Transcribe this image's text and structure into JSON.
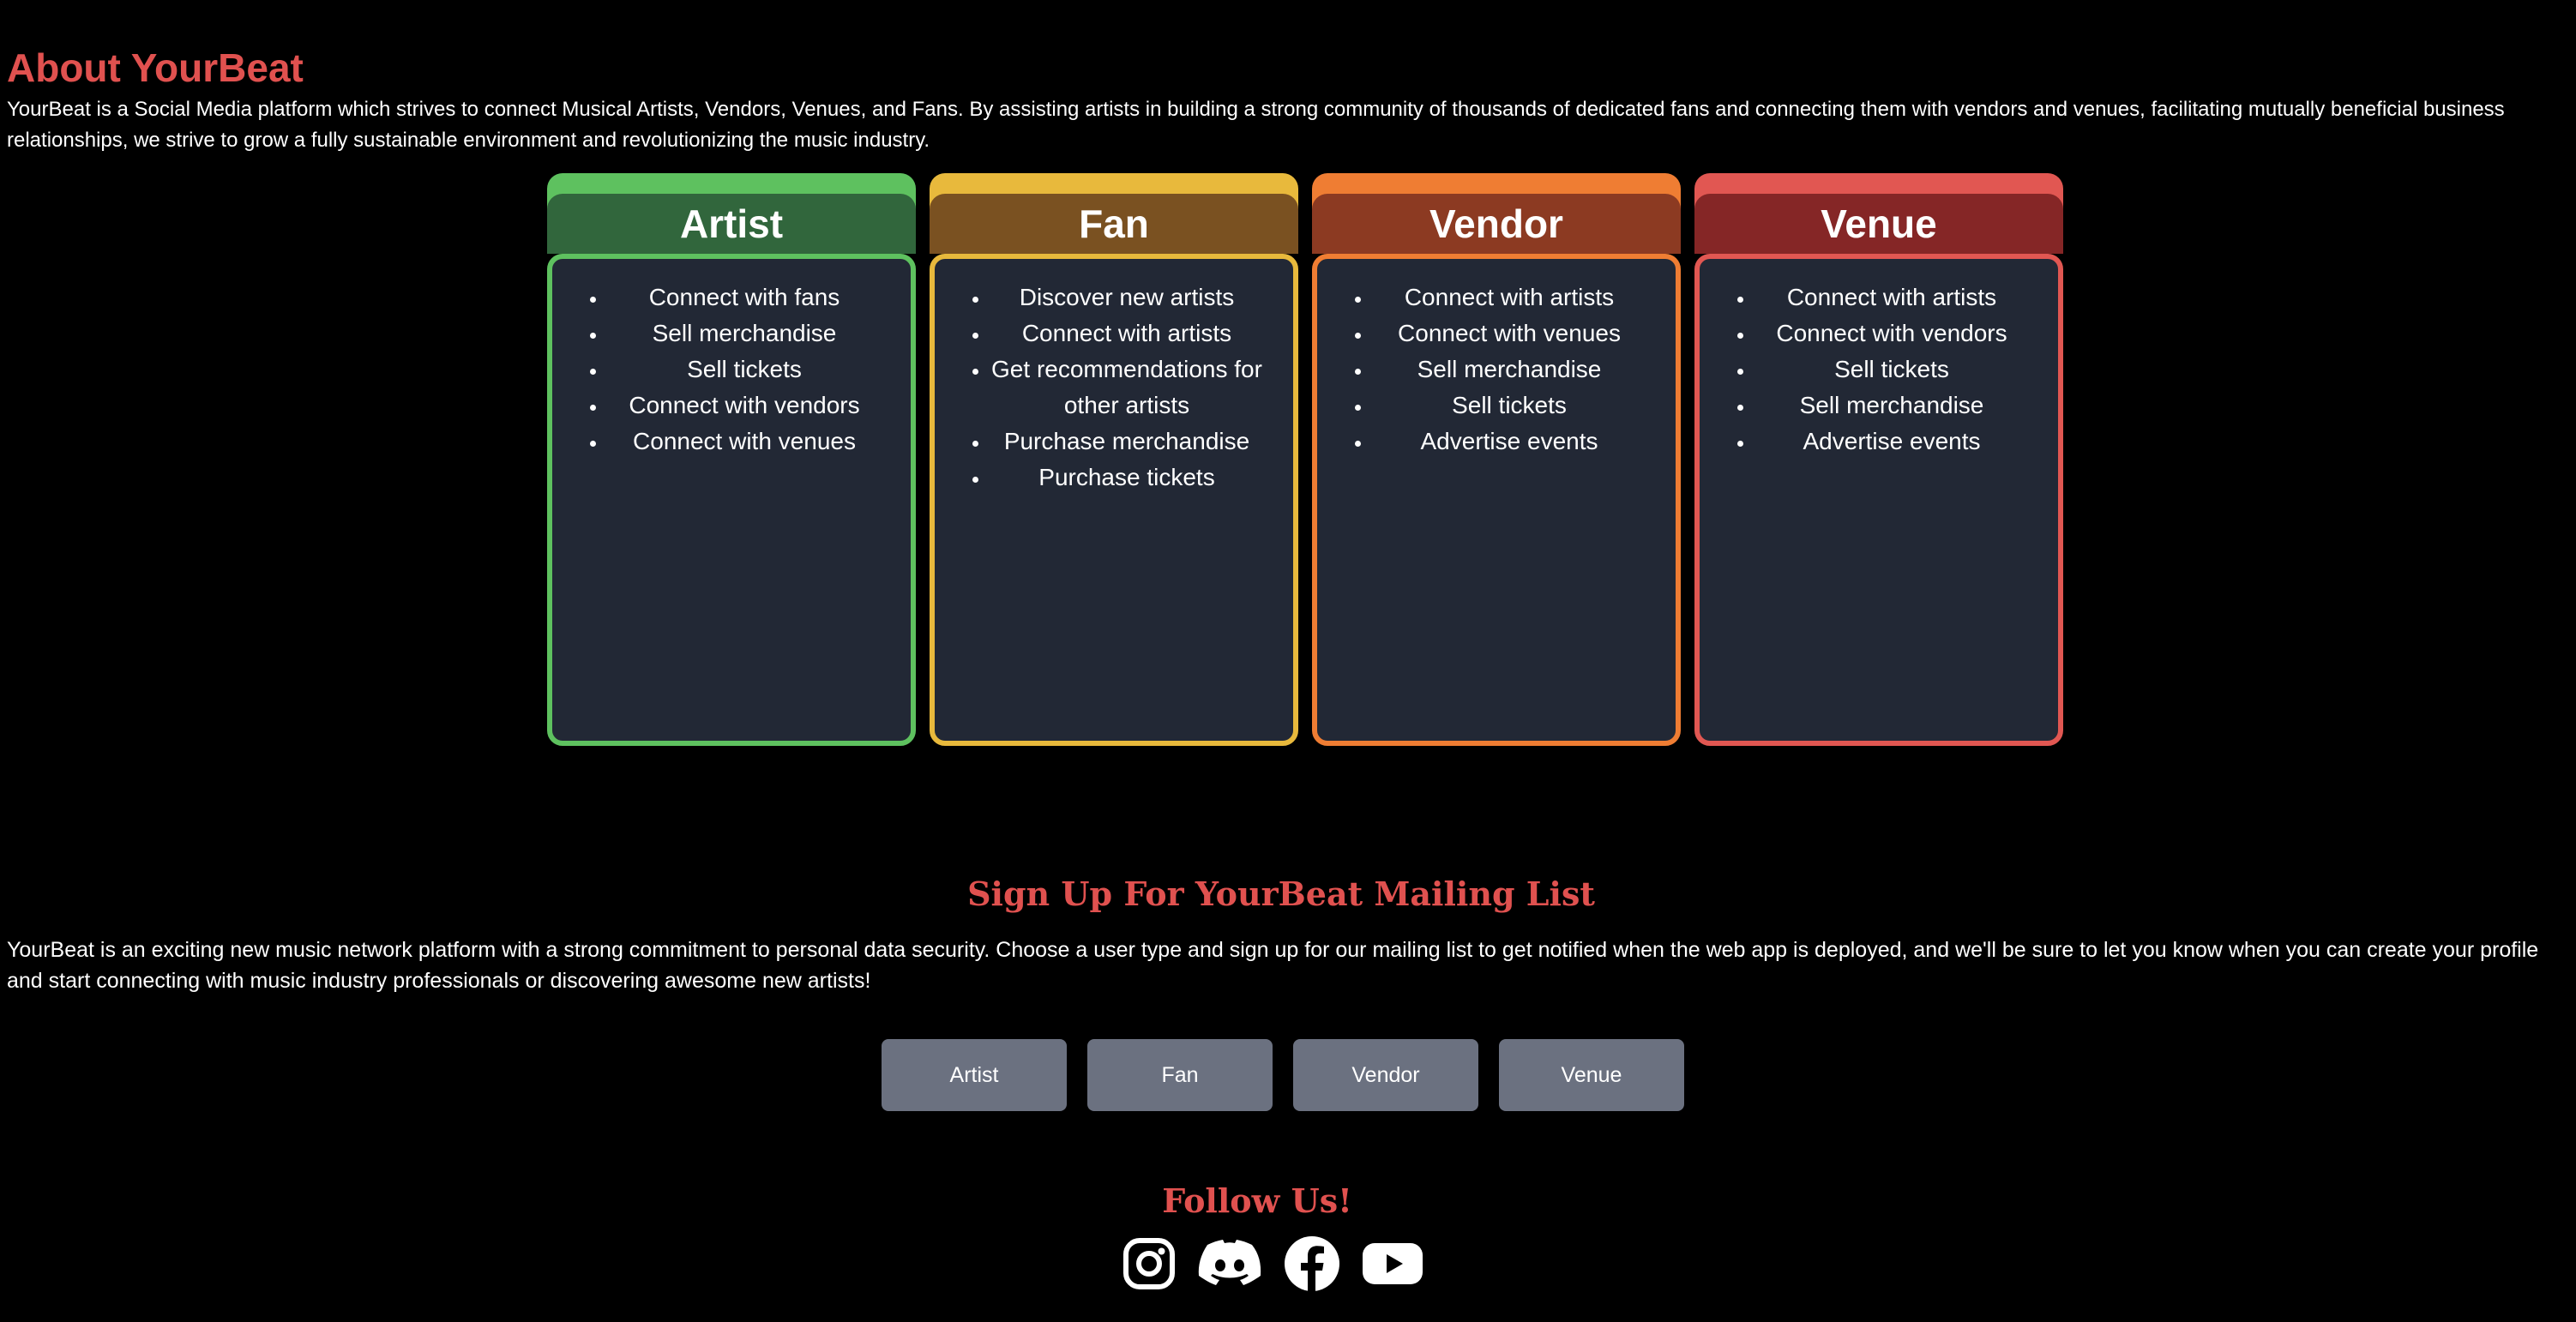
{
  "about": {
    "title": "About YourBeat",
    "description": "YourBeat is a Social Media platform which strives to connect Musical Artists, Vendors, Venues, and Fans. By assisting artists in building a strong community of thousands of dedicated fans and connecting them with vendors and venues, facilitating mutually beneficial business relationships, we strive to grow a fully sustainable environment and revolutionizing the music industry."
  },
  "cards": [
    {
      "title": "Artist",
      "items": [
        "Connect with fans",
        "Sell merchandise",
        "Sell tickets",
        "Connect with vendors",
        "Connect with venues"
      ]
    },
    {
      "title": "Fan",
      "items": [
        "Discover new artists",
        "Connect with artists",
        "Get recommendations for other artists",
        "Purchase merchandise",
        "Purchase tickets"
      ]
    },
    {
      "title": "Vendor",
      "items": [
        "Connect with artists",
        "Connect with venues",
        "Sell merchandise",
        "Sell tickets",
        "Advertise events"
      ]
    },
    {
      "title": "Venue",
      "items": [
        "Connect with artists",
        "Connect with vendors",
        "Sell tickets",
        "Sell merchandise",
        "Advertise events"
      ]
    }
  ],
  "signup": {
    "title": "Sign Up For YourBeat Mailing List",
    "description": "YourBeat is an exciting new music network platform with a strong commitment to personal data security. Choose a user type and sign up for our mailing list to get notified when the web app is deployed, and we'll be sure to let you know when you can create your profile and start connecting with music industry professionals or discovering awesome new artists!",
    "buttons": [
      "Artist",
      "Fan",
      "Vendor",
      "Venue"
    ]
  },
  "follow": {
    "title": "Follow Us!",
    "icons": [
      "instagram-icon",
      "discord-icon",
      "facebook-icon",
      "youtube-icon"
    ]
  },
  "colors": {
    "accent": "#e0514f",
    "artist": "#5ec15f",
    "fan": "#e8b93c",
    "vendor": "#ef7d33",
    "venue": "#e15752",
    "card_body": "#222835",
    "button": "#6b7180"
  }
}
